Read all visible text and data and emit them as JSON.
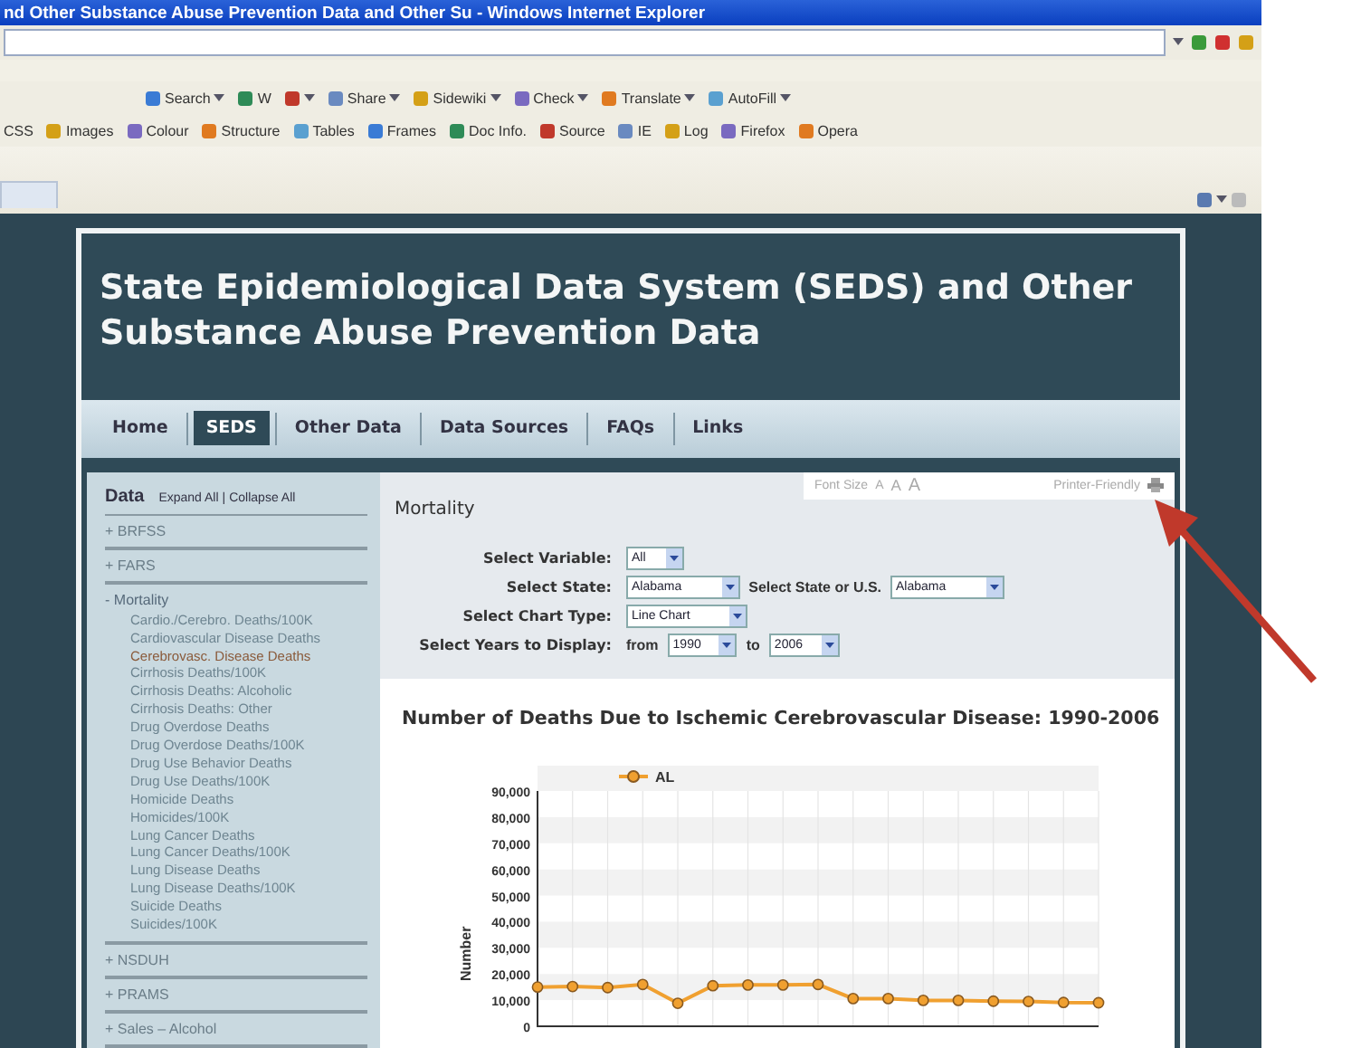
{
  "window": {
    "title": "nd Other Substance Abuse Prevention Data and Other Su - Windows Internet Explorer"
  },
  "toolbar_1": [
    {
      "label": "Search",
      "caret": true
    },
    {
      "label": "W",
      "caret": false
    },
    {
      "caret": true
    },
    {
      "label": "Share",
      "caret": true
    },
    {
      "label": "Sidewiki",
      "caret": true
    },
    {
      "label": "Check",
      "caret": true
    },
    {
      "label": "Translate",
      "caret": true
    },
    {
      "label": "AutoFill",
      "caret": true
    }
  ],
  "toolbar_2": [
    "CSS",
    "Images",
    "Colour",
    "Structure",
    "Tables",
    "Frames",
    "Doc Info.",
    "Source",
    "IE",
    "Log",
    "Firefox",
    "Opera"
  ],
  "site": {
    "title": "State Epidemiological Data System (SEDS) and Other Substance Abuse Prevention Data",
    "nav": [
      {
        "label": "Home",
        "selected": false
      },
      {
        "label": "SEDS",
        "selected": true
      },
      {
        "label": "Other Data",
        "selected": false
      },
      {
        "label": "Data Sources",
        "selected": false
      },
      {
        "label": "FAQs",
        "selected": false
      },
      {
        "label": "Links",
        "selected": false
      }
    ]
  },
  "sidebar": {
    "title": "Data",
    "expand_all": "Expand All",
    "separator": "|",
    "collapse_all": "Collapse All",
    "sections": [
      {
        "toggle": "+",
        "label": "BRFSS",
        "expanded": false
      },
      {
        "toggle": "+",
        "label": "FARS",
        "expanded": false
      },
      {
        "toggle": "-",
        "label": "Mortality",
        "expanded": true,
        "children": [
          {
            "label": "Cardio./Cerebro. Deaths/100K",
            "selected": false
          },
          {
            "label": "Cardiovascular Disease Deaths",
            "selected": false
          },
          {
            "label": "Cerebrovasc. Disease Deaths",
            "selected": true
          },
          {
            "label": "Cirrhosis Deaths/100K",
            "selected": false
          },
          {
            "label": "Cirrhosis Deaths: Alcoholic",
            "selected": false
          },
          {
            "label": "Cirrhosis Deaths: Other",
            "selected": false
          },
          {
            "label": "Drug Overdose Deaths",
            "selected": false
          },
          {
            "label": "Drug Overdose Deaths/100K",
            "selected": false
          },
          {
            "label": "Drug Use Behavior Deaths",
            "selected": false
          },
          {
            "label": "Drug Use Deaths/100K",
            "selected": false
          },
          {
            "label": "Homicide Deaths",
            "selected": false
          },
          {
            "label": "Homicides/100K",
            "selected": false
          },
          {
            "label": "Lung Cancer Deaths",
            "selected": false
          },
          {
            "label": "Lung Cancer Deaths/100K",
            "selected": false
          },
          {
            "label": "Lung Disease Deaths",
            "selected": false
          },
          {
            "label": "Lung Disease Deaths/100K",
            "selected": false
          },
          {
            "label": "Suicide Deaths",
            "selected": false
          },
          {
            "label": "Suicides/100K",
            "selected": false
          }
        ]
      },
      {
        "toggle": "+",
        "label": "NSDUH",
        "expanded": false
      },
      {
        "toggle": "+",
        "label": "PRAMS",
        "expanded": false
      },
      {
        "toggle": "+",
        "label": "Sales – Alcohol",
        "expanded": false
      }
    ]
  },
  "tools": {
    "font_size_label": "Font Size",
    "font_sizes": [
      "A",
      "A",
      "A"
    ],
    "printer_friendly": "Printer-Friendly"
  },
  "main": {
    "heading": "Mortality",
    "form": [
      {
        "label": "Select Variable:",
        "fields": [
          {
            "value": "All"
          }
        ]
      },
      {
        "label": "Select State:",
        "fields": [
          {
            "value": "Alabama"
          },
          {
            "prefix": "Select State or U.S.",
            "value": "Alabama"
          }
        ]
      },
      {
        "label": "Select Chart Type:",
        "fields": [
          {
            "value": "Line Chart"
          }
        ]
      },
      {
        "label": "Select Years to Display:",
        "fields": [
          {
            "prefix": "from",
            "value": "1990"
          },
          {
            "prefix": "to",
            "value": "2006"
          }
        ]
      }
    ],
    "chart_title": "Number of Deaths Due to Ischemic Cerebrovascular Disease: 1990-2006",
    "chart_data": {
      "type": "line",
      "grid": true,
      "ylabel": "Number",
      "ylim": [
        0,
        90000
      ],
      "yticks": [
        {
          "value": 0,
          "label": "0"
        },
        {
          "value": 10000,
          "label": "10,000"
        },
        {
          "value": 20000,
          "label": "20,000"
        },
        {
          "value": 30000,
          "label": "30,000"
        },
        {
          "value": 40000,
          "label": "40,000"
        },
        {
          "value": 50000,
          "label": "50,000"
        },
        {
          "value": 60000,
          "label": "60,000"
        },
        {
          "value": 70000,
          "label": "70,000"
        },
        {
          "value": 80000,
          "label": "80,000"
        },
        {
          "value": 90000,
          "label": "90,000"
        }
      ],
      "series": [
        {
          "name": "AL",
          "color": "#f0a030",
          "marker": "circle",
          "values": [
            15000,
            15200,
            14800,
            16000,
            8800,
            15500,
            15800,
            15800,
            16000,
            10600,
            10600,
            9900,
            9900,
            9600,
            9500,
            9100,
            9000
          ]
        }
      ]
    }
  }
}
